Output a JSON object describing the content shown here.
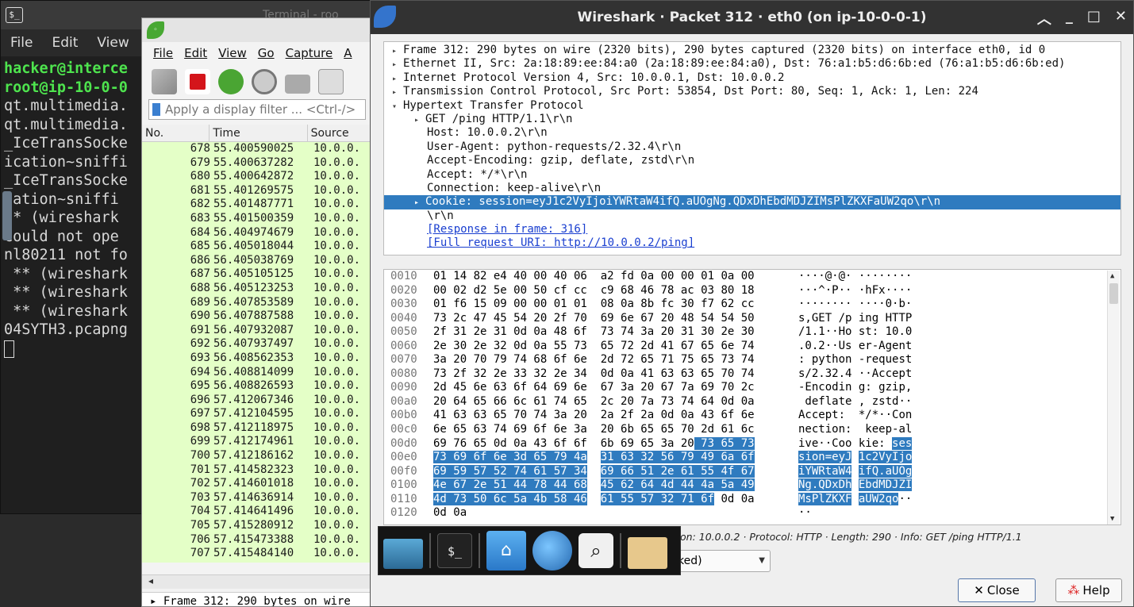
{
  "terminal": {
    "title": "Terminal - roo",
    "menu": [
      "File",
      "Edit",
      "View"
    ],
    "lines": [
      {
        "text": "hacker@interce",
        "green": true
      },
      {
        "text": "root@ip-10-0-0",
        "green": true
      },
      {
        "text": "qt.multimedia.",
        "green": false
      },
      {
        "text": "qt.multimedia.",
        "green": false
      },
      {
        "text": "_IceTransSocke",
        "green": false
      },
      {
        "text": "ication~sniffi",
        "green": false
      },
      {
        "text": "_IceTransSocke",
        "green": false
      },
      {
        "text": "cation~sniffi",
        "green": false
      },
      {
        "text": "** (wireshark",
        "green": false
      },
      {
        "text": "Could not ope",
        "green": false
      },
      {
        "text": "nl80211 not fo",
        "green": false
      },
      {
        "text": " ** (wireshark",
        "green": false
      },
      {
        "text": " ** (wireshark",
        "green": false
      },
      {
        "text": " ** (wireshark",
        "green": false
      },
      {
        "text": "04SYTH3.pcapng",
        "green": false
      }
    ]
  },
  "wireshark_main": {
    "menu": [
      "File",
      "Edit",
      "View",
      "Go",
      "Capture",
      "A"
    ],
    "filter_placeholder": "Apply a display filter ... <Ctrl-/>",
    "columns": [
      "No.",
      "Time",
      "Source"
    ],
    "packets": [
      [
        "678",
        "55.400590025",
        "10.0.0."
      ],
      [
        "679",
        "55.400637282",
        "10.0.0."
      ],
      [
        "680",
        "55.400642872",
        "10.0.0."
      ],
      [
        "681",
        "55.401269575",
        "10.0.0."
      ],
      [
        "682",
        "55.401487771",
        "10.0.0."
      ],
      [
        "683",
        "55.401500359",
        "10.0.0."
      ],
      [
        "684",
        "56.404974679",
        "10.0.0."
      ],
      [
        "685",
        "56.405018044",
        "10.0.0."
      ],
      [
        "686",
        "56.405038769",
        "10.0.0."
      ],
      [
        "687",
        "56.405105125",
        "10.0.0."
      ],
      [
        "688",
        "56.405123253",
        "10.0.0."
      ],
      [
        "689",
        "56.407853589",
        "10.0.0."
      ],
      [
        "690",
        "56.407887588",
        "10.0.0."
      ],
      [
        "691",
        "56.407932087",
        "10.0.0."
      ],
      [
        "692",
        "56.407937497",
        "10.0.0."
      ],
      [
        "693",
        "56.408562353",
        "10.0.0."
      ],
      [
        "694",
        "56.408814099",
        "10.0.0."
      ],
      [
        "695",
        "56.408826593",
        "10.0.0."
      ],
      [
        "696",
        "57.412067346",
        "10.0.0."
      ],
      [
        "697",
        "57.412104595",
        "10.0.0."
      ],
      [
        "698",
        "57.412118975",
        "10.0.0."
      ],
      [
        "699",
        "57.412174961",
        "10.0.0."
      ],
      [
        "700",
        "57.412186162",
        "10.0.0."
      ],
      [
        "701",
        "57.414582323",
        "10.0.0."
      ],
      [
        "702",
        "57.414601018",
        "10.0.0."
      ],
      [
        "703",
        "57.414636914",
        "10.0.0."
      ],
      [
        "704",
        "57.414641496",
        "10.0.0."
      ],
      [
        "705",
        "57.415280912",
        "10.0.0."
      ],
      [
        "706",
        "57.415473388",
        "10.0.0."
      ],
      [
        "707",
        "57.415484140",
        "10.0.0."
      ]
    ],
    "detail_line": "Frame 312: 290 bytes on wire"
  },
  "dialog": {
    "title": "Wireshark · Packet 312 · eth0 (on ip-10-0-0-1)",
    "tree": [
      {
        "text": "Frame 312: 290 bytes on wire (2320 bits), 290 bytes captured (2320 bits) on interface eth0, id 0",
        "arrow": "▸",
        "level": 0
      },
      {
        "text": "Ethernet II, Src: 2a:18:89:ee:84:a0 (2a:18:89:ee:84:a0), Dst: 76:a1:b5:d6:6b:ed (76:a1:b5:d6:6b:ed)",
        "arrow": "▸",
        "level": 0
      },
      {
        "text": "Internet Protocol Version 4, Src: 10.0.0.1, Dst: 10.0.0.2",
        "arrow": "▸",
        "level": 0
      },
      {
        "text": "Transmission Control Protocol, Src Port: 53854, Dst Port: 80, Seq: 1, Ack: 1, Len: 224",
        "arrow": "▸",
        "level": 0
      },
      {
        "text": "Hypertext Transfer Protocol",
        "arrow": "▾",
        "level": 0
      },
      {
        "text": "GET /ping HTTP/1.1\\r\\n",
        "arrow": "▸",
        "level": 1
      },
      {
        "text": "Host: 10.0.0.2\\r\\n",
        "arrow": "",
        "level": 2
      },
      {
        "text": "User-Agent: python-requests/2.32.4\\r\\n",
        "arrow": "",
        "level": 2
      },
      {
        "text": "Accept-Encoding: gzip, deflate, zstd\\r\\n",
        "arrow": "",
        "level": 2
      },
      {
        "text": "Accept: */*\\r\\n",
        "arrow": "",
        "level": 2
      },
      {
        "text": "Connection: keep-alive\\r\\n",
        "arrow": "",
        "level": 2
      },
      {
        "text": "Cookie: session=eyJ1c2VyIjoiYWRtaW4ifQ.aUOgNg.QDxDhEbdMDJZIMsPlZKXFaUW2qo\\r\\n",
        "arrow": "▸",
        "level": 1,
        "selected": true
      },
      {
        "text": "\\r\\n",
        "arrow": "",
        "level": 2
      },
      {
        "text": "[Response in frame: 316]",
        "arrow": "",
        "level": 2,
        "link": true
      },
      {
        "text": "[Full request URI: http://10.0.0.2/ping]",
        "arrow": "",
        "level": 2,
        "link": true
      }
    ],
    "hex": [
      {
        "off": "0010",
        "a": "01 14 82 e4 40 00 40 06",
        "ah": "",
        "b": "a2 fd 0a 00 00 01 0a 00",
        "bh": "",
        "asc1": "····@·@·",
        "asc1h": "",
        "asc2": "········",
        "asc2h": ""
      },
      {
        "off": "0020",
        "a": "00 02 d2 5e 00 50 cf cc",
        "ah": "",
        "b": "c9 68 46 78 ac 03 80 18",
        "bh": "",
        "asc1": "···^·P··",
        "asc1h": "",
        "asc2": "·hFx····",
        "asc2h": ""
      },
      {
        "off": "0030",
        "a": "01 f6 15 09 00 00 01 01",
        "ah": "",
        "b": "08 0a 8b fc 30 f7 62 cc",
        "bh": "",
        "asc1": "········",
        "asc1h": "",
        "asc2": "····0·b·",
        "asc2h": ""
      },
      {
        "off": "0040",
        "a": "73 2c 47 45 54 20 2f 70",
        "ah": "",
        "b": "69 6e 67 20 48 54 54 50",
        "bh": "",
        "asc1": "s,GET /p",
        "asc1h": "",
        "asc2": "ing HTTP",
        "asc2h": ""
      },
      {
        "off": "0050",
        "a": "2f 31 2e 31 0d 0a 48 6f",
        "ah": "",
        "b": "73 74 3a 20 31 30 2e 30",
        "bh": "",
        "asc1": "/1.1··Ho",
        "asc1h": "",
        "asc2": "st: 10.0",
        "asc2h": ""
      },
      {
        "off": "0060",
        "a": "2e 30 2e 32 0d 0a 55 73",
        "ah": "",
        "b": "65 72 2d 41 67 65 6e 74",
        "bh": "",
        "asc1": ".0.2··Us",
        "asc1h": "",
        "asc2": "er-Agent",
        "asc2h": ""
      },
      {
        "off": "0070",
        "a": "3a 20 70 79 74 68 6f 6e",
        "ah": "",
        "b": "2d 72 65 71 75 65 73 74",
        "bh": "",
        "asc1": ": python",
        "asc1h": "",
        "asc2": "-request",
        "asc2h": ""
      },
      {
        "off": "0080",
        "a": "73 2f 32 2e 33 32 2e 34",
        "ah": "",
        "b": "0d 0a 41 63 63 65 70 74",
        "bh": "",
        "asc1": "s/2.32.4",
        "asc1h": "",
        "asc2": "··Accept",
        "asc2h": ""
      },
      {
        "off": "0090",
        "a": "2d 45 6e 63 6f 64 69 6e",
        "ah": "",
        "b": "67 3a 20 67 7a 69 70 2c",
        "bh": "",
        "asc1": "-Encodin",
        "asc1h": "",
        "asc2": "g: gzip,",
        "asc2h": ""
      },
      {
        "off": "00a0",
        "a": "20 64 65 66 6c 61 74 65",
        "ah": "",
        "b": "2c 20 7a 73 74 64 0d 0a",
        "bh": "",
        "asc1": " deflate",
        "asc1h": "",
        "asc2": ", zstd··",
        "asc2h": ""
      },
      {
        "off": "00b0",
        "a": "41 63 63 65 70 74 3a 20",
        "ah": "",
        "b": "2a 2f 2a 0d 0a 43 6f 6e",
        "bh": "",
        "asc1": "Accept: ",
        "asc1h": "",
        "asc2": "*/*··Con",
        "asc2h": ""
      },
      {
        "off": "00c0",
        "a": "6e 65 63 74 69 6f 6e 3a",
        "ah": "",
        "b": "20 6b 65 65 70 2d 61 6c",
        "bh": "",
        "asc1": "nection:",
        "asc1h": "",
        "asc2": " keep-al",
        "asc2h": ""
      },
      {
        "off": "00d0",
        "a": "69 76 65 0d 0a 43 6f 6f",
        "ah": "",
        "b": "6b 69 65 3a 20",
        "bh": " 73 65 73",
        "asc1": "ive··Coo",
        "asc1h": "",
        "asc2": "kie: ",
        "asc2h": "ses"
      },
      {
        "off": "00e0",
        "a": "",
        "ah": "73 69 6f 6e 3d 65 79 4a",
        "b": "",
        "bh": "31 63 32 56 79 49 6a 6f",
        "asc1": "",
        "asc1h": "sion=eyJ",
        "asc2": "",
        "asc2h": "1c2VyIjo"
      },
      {
        "off": "00f0",
        "a": "",
        "ah": "69 59 57 52 74 61 57 34",
        "b": "",
        "bh": "69 66 51 2e 61 55 4f 67",
        "asc1": "",
        "asc1h": "iYWRtaW4",
        "asc2": "",
        "asc2h": "ifQ.aUOg"
      },
      {
        "off": "0100",
        "a": "",
        "ah": "4e 67 2e 51 44 78 44 68",
        "b": "",
        "bh": "45 62 64 4d 44 4a 5a 49",
        "asc1": "",
        "asc1h": "Ng.QDxDh",
        "asc2": "",
        "asc2h": "EbdMDJZI"
      },
      {
        "off": "0110",
        "a": "",
        "ah": "4d 73 50 6c 5a 4b 58 46",
        "b": "",
        "bh": "61 55 57 32 71 6f",
        "btail": " 0d 0a",
        "asc1": "",
        "asc1h": "MsPlZKXF",
        "asc2": "",
        "asc2h": "aUW2qo",
        "asc2tail": "··"
      },
      {
        "off": "0120",
        "a": "0d 0a",
        "ah": "",
        "b": "",
        "bh": "",
        "asc1": "··",
        "asc1h": "",
        "asc2": "",
        "asc2h": ""
      }
    ],
    "status": "on: 10.0.0.2 · Protocol: HTTP · Length: 290 · Info: GET /ping HTTP/1.1",
    "combo_value": "ked)",
    "close_label": "Close",
    "help_label": "Help"
  },
  "dock": {
    "terminal_glyph": "$_"
  }
}
